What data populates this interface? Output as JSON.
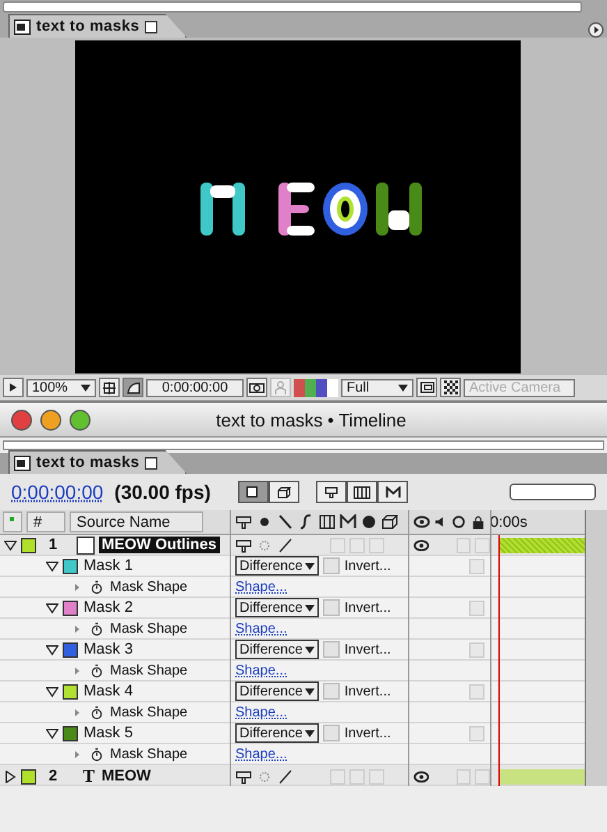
{
  "comp_window": {
    "tab": "text to masks",
    "toolbar": {
      "zoom": "100%",
      "time": "0:00:00:00",
      "resolution": "Full",
      "camera": "Active Camera"
    }
  },
  "timeline_window": {
    "title": "text to masks • Timeline",
    "tab": "text to masks",
    "current_time": "0:00:00:00",
    "fps": "(30.00 fps)",
    "columns": {
      "number": "#",
      "source": "Source Name",
      "ruler": "0:00s"
    },
    "rows": [
      {
        "kind": "layer",
        "number": "1",
        "name": "MEOW Outlines",
        "color": "#b0e02a",
        "expanded": true,
        "selected": true
      },
      {
        "kind": "mask",
        "name": "Mask 1",
        "color": "#40c8c8",
        "mode": "Difference",
        "invert_label": "Invert...",
        "inverted": false,
        "expanded": true
      },
      {
        "kind": "property",
        "name": "Mask Shape",
        "value": "Shape..."
      },
      {
        "kind": "mask",
        "name": "Mask 2",
        "color": "#e080c8",
        "mode": "Difference",
        "invert_label": "Invert...",
        "inverted": false,
        "expanded": true
      },
      {
        "kind": "property",
        "name": "Mask Shape",
        "value": "Shape..."
      },
      {
        "kind": "mask",
        "name": "Mask 3",
        "color": "#3060e0",
        "mode": "Difference",
        "invert_label": "Invert...",
        "inverted": false,
        "expanded": true
      },
      {
        "kind": "property",
        "name": "Mask Shape",
        "value": "Shape..."
      },
      {
        "kind": "mask",
        "name": "Mask 4",
        "color": "#b0e030",
        "mode": "Difference",
        "invert_label": "Invert...",
        "inverted": false,
        "expanded": true
      },
      {
        "kind": "property",
        "name": "Mask Shape",
        "value": "Shape..."
      },
      {
        "kind": "mask",
        "name": "Mask 5",
        "color": "#4a8a18",
        "mode": "Difference",
        "invert_label": "Invert...",
        "inverted": false,
        "expanded": true
      },
      {
        "kind": "property",
        "name": "Mask Shape",
        "value": "Shape..."
      },
      {
        "kind": "layer",
        "number": "2",
        "name": "MEOW",
        "type_glyph": "T",
        "color": "#b0e02a",
        "expanded": false,
        "selected": false
      }
    ]
  }
}
